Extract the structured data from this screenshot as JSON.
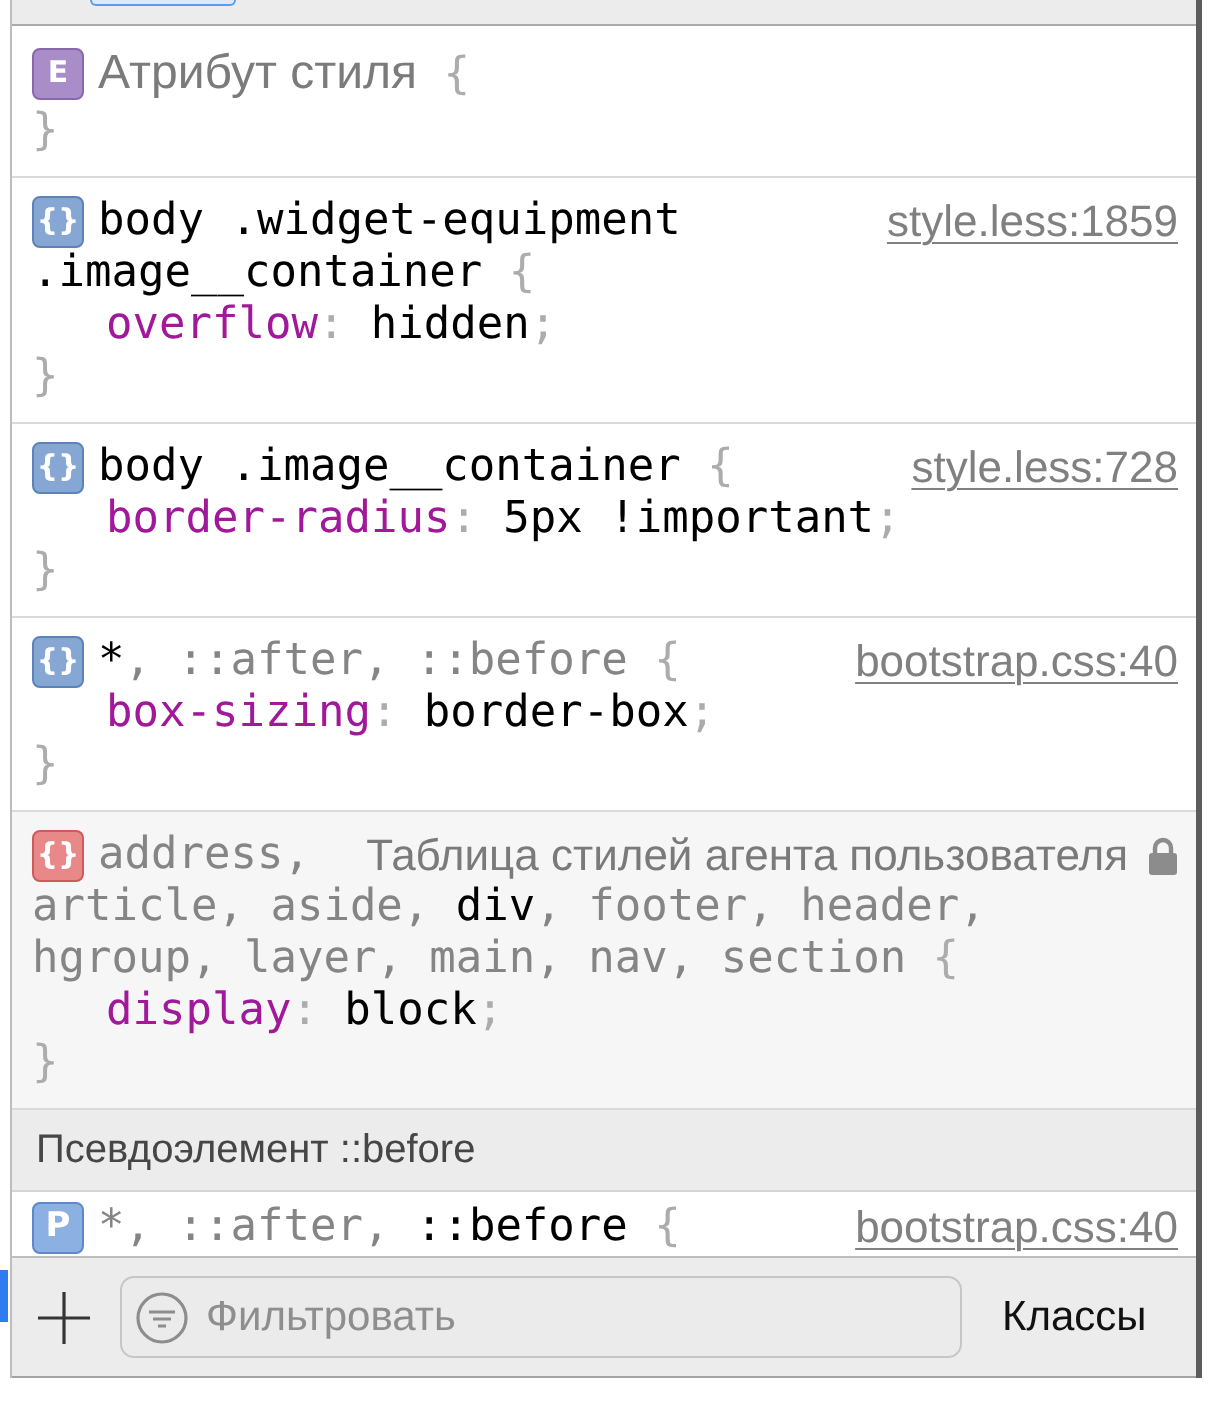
{
  "styles": [
    {
      "kind": "attribute",
      "badge": "E",
      "title": "Атрибут стиля",
      "open": "{",
      "close": "}"
    },
    {
      "kind": "author",
      "badge": "{}",
      "selector": [
        [
          {
            "text": "body .widget-equipment",
            "matched": true
          }
        ],
        [
          {
            "text": ".image__container",
            "matched": true
          }
        ]
      ],
      "open": "{",
      "declarations": [
        {
          "property": "overflow",
          "colon": ":",
          "value": "hidden",
          "semicolon": ";"
        }
      ],
      "close": "}",
      "source": "style.less:1859",
      "locked": false
    },
    {
      "kind": "author",
      "badge": "{}",
      "selector": [
        [
          {
            "text": "body .image__container",
            "matched": true
          }
        ]
      ],
      "open": "{",
      "declarations": [
        {
          "property": "border-radius",
          "colon": ":",
          "value": "5px !important",
          "semicolon": ";"
        }
      ],
      "close": "}",
      "source": "style.less:728",
      "locked": false
    },
    {
      "kind": "author",
      "badge": "{}",
      "selector": [
        [
          {
            "text": "*",
            "matched": true
          },
          {
            "text": ", ::after, ::before",
            "matched": false
          }
        ]
      ],
      "open": "{",
      "declarations": [
        {
          "property": "box-sizing",
          "colon": ":",
          "value": "border-box",
          "semicolon": ";"
        }
      ],
      "close": "}",
      "source": "bootstrap.css:40",
      "locked": false
    },
    {
      "kind": "user_agent",
      "badge": "{}",
      "selector": [
        [
          {
            "text": "address,",
            "matched": false
          }
        ],
        [
          {
            "text": "article, aside, ",
            "matched": false
          },
          {
            "text": "div",
            "matched": true
          },
          {
            "text": ", footer, header,",
            "matched": false
          }
        ],
        [
          {
            "text": "hgroup, layer, main, nav, section",
            "matched": false
          }
        ]
      ],
      "open": "{",
      "declarations": [
        {
          "property": "display",
          "colon": ":",
          "value": "block",
          "semicolon": ";"
        }
      ],
      "close": "}",
      "source": "Таблица стилей агента пользователя",
      "locked": true
    },
    {
      "kind": "section_header",
      "title": "Псевдоэлемент ::before"
    },
    {
      "kind": "pseudo",
      "badge": "P",
      "selector": [
        [
          {
            "text": "*, ::after, ",
            "matched": false
          },
          {
            "text": "::before",
            "matched": true
          }
        ]
      ],
      "open": "{",
      "source": "bootstrap.css:40",
      "locked": false
    }
  ],
  "toolbar": {
    "filter": {
      "placeholder": "Фильтровать"
    },
    "classes_button": "Классы"
  }
}
